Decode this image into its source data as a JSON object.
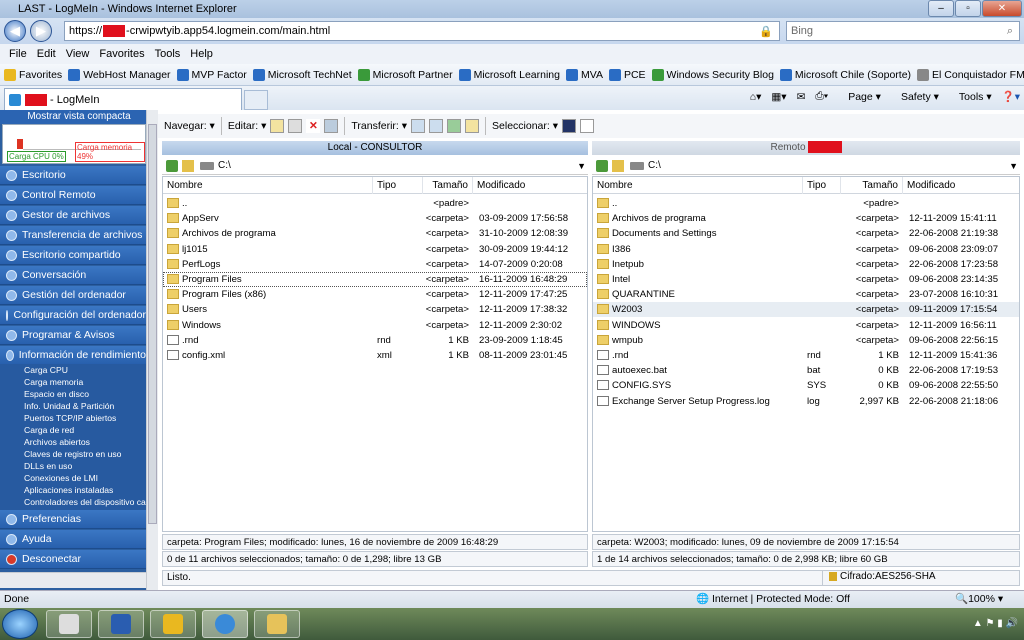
{
  "window": {
    "title": "LAST - LogMeIn - Windows Internet Explorer"
  },
  "address": {
    "url_prefix": "https://",
    "url_rest": "-crwipwtyib.app54.logmein.com/main.html"
  },
  "search": {
    "placeholder": "Bing"
  },
  "menubar": [
    "File",
    "Edit",
    "View",
    "Favorites",
    "Tools",
    "Help"
  ],
  "favorites": [
    "Favorites",
    "WebHost Manager",
    "MVP Factor",
    "Microsoft TechNet",
    "Microsoft Partner",
    "Microsoft Learning",
    "MVA",
    "PCE",
    "Windows Security Blog",
    "Microsoft Chile (Soporte)",
    "El Conquistador FM"
  ],
  "tab": {
    "label": "- LogMeIn"
  },
  "cmdbar": {
    "page": "Page",
    "safety": "Safety",
    "tools": "Tools"
  },
  "sidebar": {
    "compact": "Mostrar vista compacta",
    "cpu_label": "Carga CPU 0%",
    "mem_label": "Carga memoria 49%",
    "items": [
      "Escritorio",
      "Control Remoto",
      "Gestor de archivos",
      "Transferencia de archivos",
      "Escritorio compartido",
      "Conversación",
      "Gestión del ordenador",
      "Configuración del ordenador",
      "Programar & Avisos",
      "Información de rendimiento"
    ],
    "subitems": [
      "Carga CPU",
      "Carga memoria",
      "Espacio en disco",
      "Info. Unidad & Partición",
      "Puertos TCP/IP abiertos",
      "Carga de red",
      "Archivos abiertos",
      "Claves de registro en uso",
      "DLLs en uso",
      "Conexiones de LMI",
      "Aplicaciones instaladas",
      "Controladores del dispositivo ca"
    ],
    "bottom_items": [
      "Preferencias",
      "Ayuda",
      "Desconectar"
    ]
  },
  "fmtoolbar": {
    "navegar": "Navegar:",
    "editar": "Editar:",
    "transferir": "Transferir:",
    "seleccionar": "Seleccionar:"
  },
  "left_panel": {
    "title": "Local - CONSULTOR",
    "path": "C:\\",
    "columns": [
      "Nombre",
      "Tipo",
      "Tamaño",
      "Modificado"
    ],
    "rows": [
      {
        "name": "..",
        "type": "",
        "size": "<padre>",
        "mod": "",
        "icon": "up"
      },
      {
        "name": "AppServ",
        "type": "",
        "size": "<carpeta>",
        "mod": "03-09-2009 17:56:58",
        "icon": "folder"
      },
      {
        "name": "Archivos de programa",
        "type": "",
        "size": "<carpeta>",
        "mod": "31-10-2009 12:08:39",
        "icon": "folder"
      },
      {
        "name": "lj1015",
        "type": "",
        "size": "<carpeta>",
        "mod": "30-09-2009 19:44:12",
        "icon": "folder"
      },
      {
        "name": "PerfLogs",
        "type": "",
        "size": "<carpeta>",
        "mod": "14-07-2009 0:20:08",
        "icon": "folder"
      },
      {
        "name": "Program Files",
        "type": "",
        "size": "<carpeta>",
        "mod": "16-11-2009 16:48:29",
        "icon": "folder"
      },
      {
        "name": "Program Files (x86)",
        "type": "",
        "size": "<carpeta>",
        "mod": "12-11-2009 17:47:25",
        "icon": "folder"
      },
      {
        "name": "Users",
        "type": "",
        "size": "<carpeta>",
        "mod": "12-11-2009 17:38:32",
        "icon": "folder"
      },
      {
        "name": "Windows",
        "type": "",
        "size": "<carpeta>",
        "mod": "12-11-2009 2:30:02",
        "icon": "folder"
      },
      {
        "name": ".rnd",
        "type": "rnd",
        "size": "1 KB",
        "mod": "23-09-2009 1:18:45",
        "icon": "file"
      },
      {
        "name": "config.xml",
        "type": "xml",
        "size": "1 KB",
        "mod": "08-11-2009 23:01:45",
        "icon": "file"
      }
    ],
    "status1": "carpeta: Program Files; modificado: lunes, 16 de noviembre de 2009 16:48:29",
    "status2": "0 de 11 archivos seleccionados; tamaño: 0 de 1,298; libre 13 GB"
  },
  "right_panel": {
    "title": "Remoto",
    "path": "C:\\",
    "columns": [
      "Nombre",
      "Tipo",
      "Tamaño",
      "Modificado"
    ],
    "rows": [
      {
        "name": "..",
        "type": "",
        "size": "<padre>",
        "mod": "",
        "icon": "up"
      },
      {
        "name": "Archivos de programa",
        "type": "",
        "size": "<carpeta>",
        "mod": "12-11-2009 15:41:11",
        "icon": "folder"
      },
      {
        "name": "Documents and Settings",
        "type": "",
        "size": "<carpeta>",
        "mod": "22-06-2008 21:19:38",
        "icon": "folder"
      },
      {
        "name": "I386",
        "type": "",
        "size": "<carpeta>",
        "mod": "09-06-2008 23:09:07",
        "icon": "folder"
      },
      {
        "name": "Inetpub",
        "type": "",
        "size": "<carpeta>",
        "mod": "22-06-2008 17:23:58",
        "icon": "folder"
      },
      {
        "name": "Intel",
        "type": "",
        "size": "<carpeta>",
        "mod": "09-06-2008 23:14:35",
        "icon": "folder"
      },
      {
        "name": "QUARANTINE",
        "type": "",
        "size": "<carpeta>",
        "mod": "23-07-2008 16:10:31",
        "icon": "folder"
      },
      {
        "name": "W2003",
        "type": "",
        "size": "<carpeta>",
        "mod": "09-11-2009 17:15:54",
        "icon": "folder"
      },
      {
        "name": "WINDOWS",
        "type": "",
        "size": "<carpeta>",
        "mod": "12-11-2009 16:56:11",
        "icon": "folder"
      },
      {
        "name": "wmpub",
        "type": "",
        "size": "<carpeta>",
        "mod": "09-06-2008 22:56:15",
        "icon": "folder"
      },
      {
        "name": ".rnd",
        "type": "rnd",
        "size": "1 KB",
        "mod": "12-11-2009 15:41:36",
        "icon": "file"
      },
      {
        "name": "autoexec.bat",
        "type": "bat",
        "size": "0 KB",
        "mod": "22-06-2008 17:19:53",
        "icon": "file"
      },
      {
        "name": "CONFIG.SYS",
        "type": "SYS",
        "size": "0 KB",
        "mod": "09-06-2008 22:55:50",
        "icon": "file"
      },
      {
        "name": "Exchange Server Setup Progress.log",
        "type": "log",
        "size": "2,997 KB",
        "mod": "22-06-2008 21:18:06",
        "icon": "file"
      }
    ],
    "status1": "carpeta: W2003; modificado: lunes, 09 de noviembre de 2009 17:15:54",
    "status2": "1 de 14 archivos seleccionados; tamaño: 0 de 2,998 KB; libre 60 GB"
  },
  "bottom": {
    "listo": "Listo.",
    "cifrado": "Cifrado:AES256-SHA"
  },
  "iestatus": {
    "done": "Done",
    "zone": "Internet | Protected Mode: Off",
    "zoom": "100%"
  }
}
